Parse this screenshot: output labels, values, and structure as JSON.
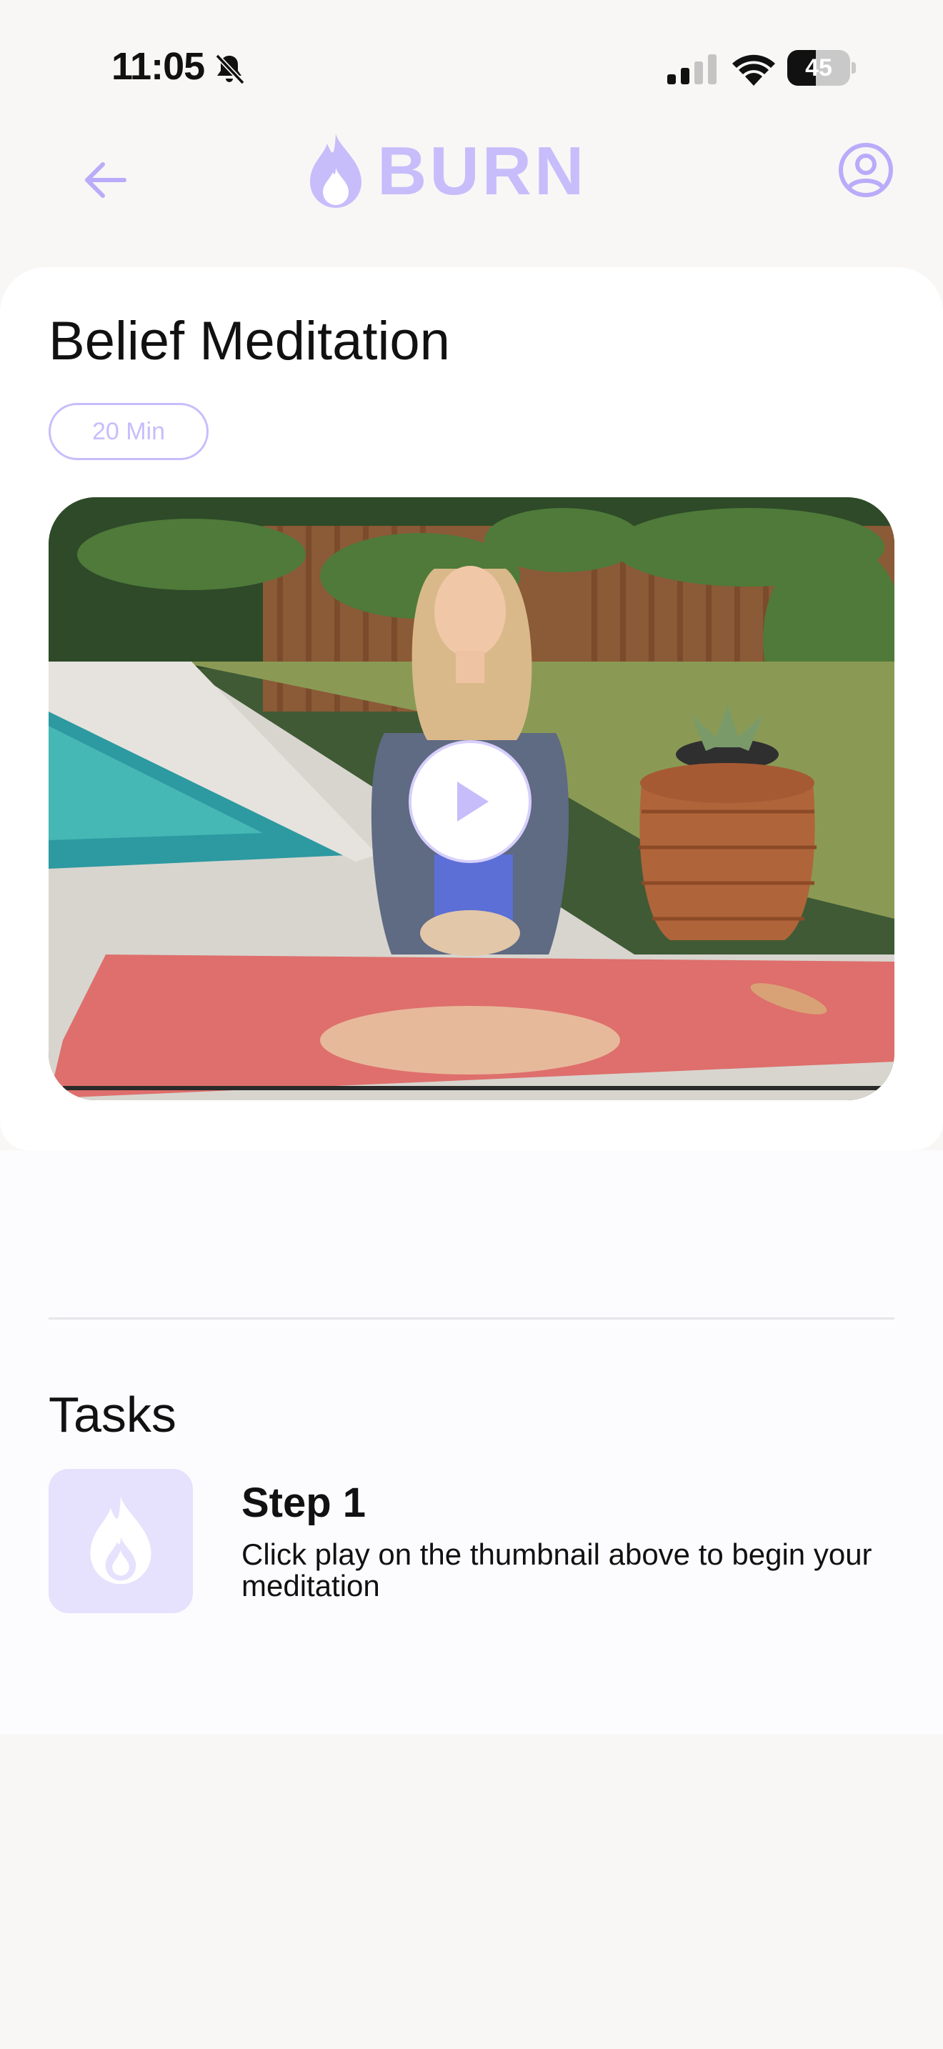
{
  "status_bar": {
    "time": "11:05",
    "battery_level": "45",
    "battery_fraction": 0.45
  },
  "header": {
    "brand_name": "BURN",
    "back_icon": "arrow-left-icon",
    "profile_icon": "user-circle-icon"
  },
  "card": {
    "title": "Belief Meditation",
    "duration": "20 Min",
    "play_icon": "play-icon"
  },
  "tasks": {
    "heading": "Tasks",
    "items": [
      {
        "icon": "flame-icon",
        "title": "Step 1",
        "description": "Click play on the thumbnail above to begin your meditation"
      }
    ]
  },
  "colors": {
    "accent": "#c8bdfb",
    "accent_soft": "#e6e1fd",
    "background": "#f8f7f5",
    "card": "#ffffff"
  }
}
